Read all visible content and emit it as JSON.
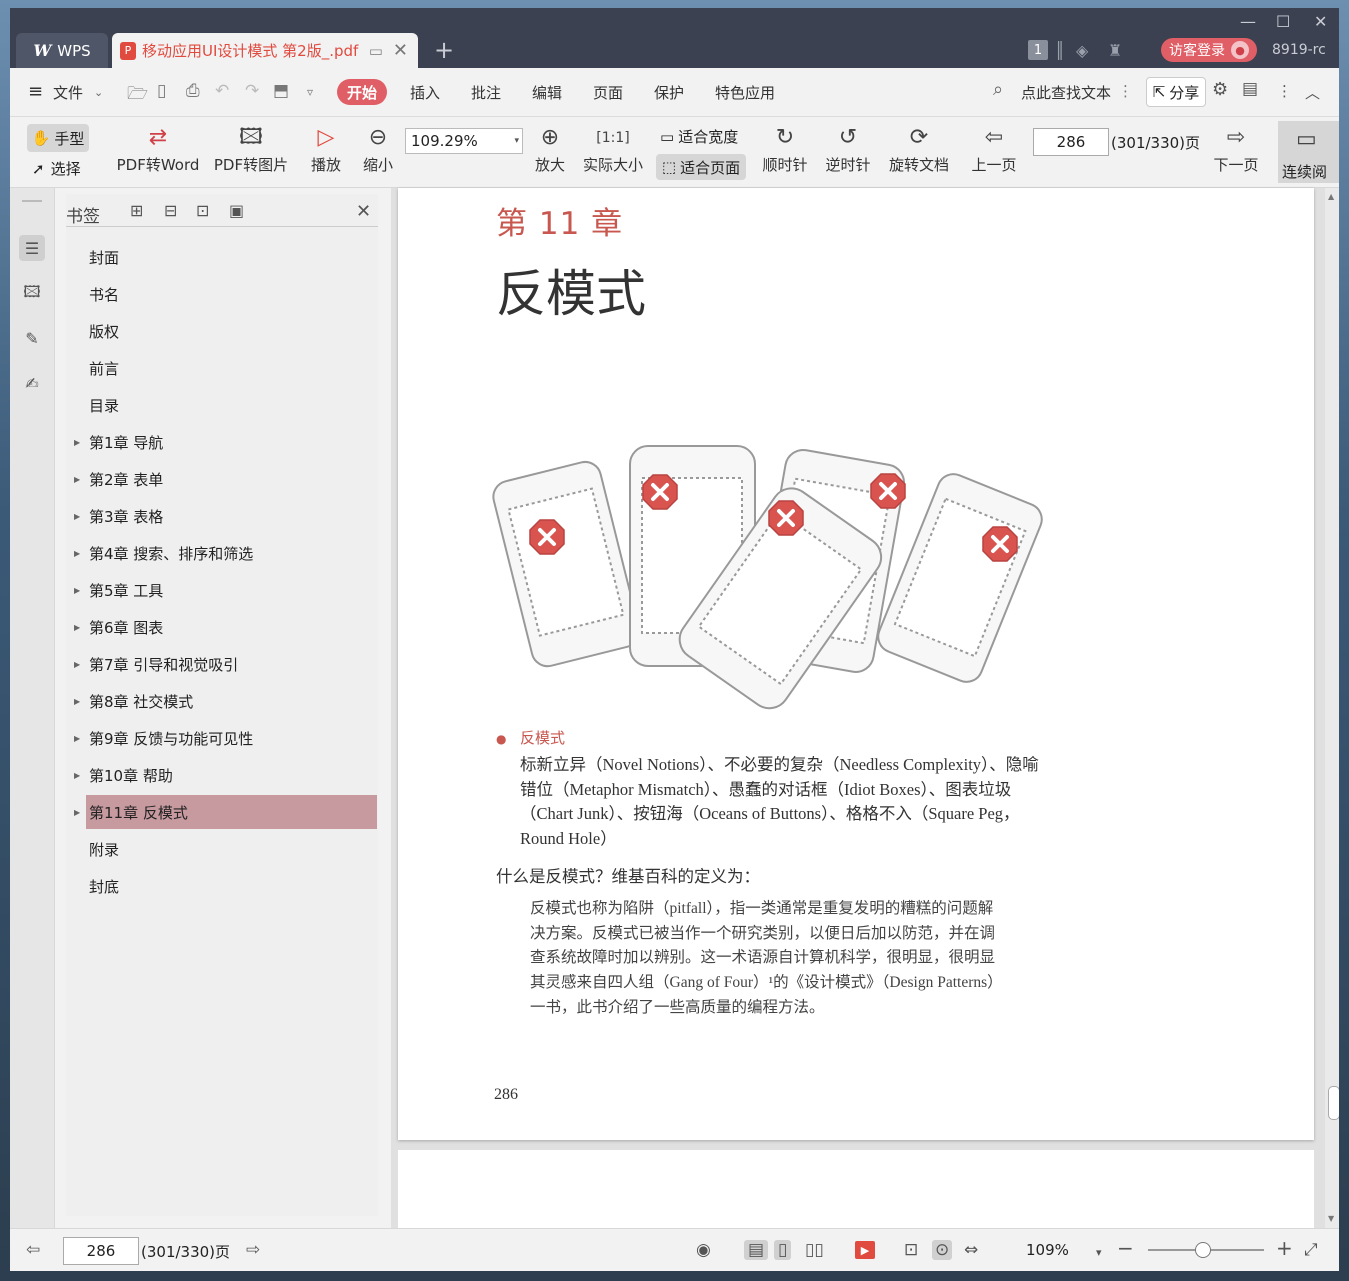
{
  "titlebar": {
    "app_tab": "WPS",
    "doc_tab": "移动应用UI设计模式 第2版_.pdf",
    "badge": "1",
    "login": "访客登录",
    "user": "8919-rc"
  },
  "menu": {
    "file": "文件",
    "tabs": [
      "开始",
      "插入",
      "批注",
      "编辑",
      "页面",
      "保护",
      "特色应用"
    ],
    "search_text": "点此查找文本",
    "share": "分享"
  },
  "toolbar": {
    "hand": "手型",
    "select": "选择",
    "pdf_to_word": "PDF转Word",
    "pdf_to_image": "PDF转图片",
    "play": "播放",
    "zoom_out": "缩小",
    "zoom_value": "109.29%",
    "zoom_in": "放大",
    "actual_size": "实际大小",
    "fit_width": "适合宽度",
    "fit_page": "适合页面",
    "clockwise": "顺时针",
    "counter_clockwise": "逆时针",
    "rotate_doc": "旋转文档",
    "prev_page": "上一页",
    "page_current": "286",
    "page_total": "(301/330)页",
    "next_page": "下一页",
    "continuous": "连续阅"
  },
  "bookmarks": {
    "title": "书签",
    "items": [
      {
        "label": "封面",
        "expandable": false,
        "selected": false
      },
      {
        "label": "书名",
        "expandable": false,
        "selected": false
      },
      {
        "label": "版权",
        "expandable": false,
        "selected": false
      },
      {
        "label": "前言",
        "expandable": false,
        "selected": false
      },
      {
        "label": "目录",
        "expandable": false,
        "selected": false
      },
      {
        "label": "第1章  导航",
        "expandable": true,
        "selected": false
      },
      {
        "label": "第2章  表单",
        "expandable": true,
        "selected": false
      },
      {
        "label": "第3章  表格",
        "expandable": true,
        "selected": false
      },
      {
        "label": "第4章  搜索、排序和筛选",
        "expandable": true,
        "selected": false
      },
      {
        "label": "第5章  工具",
        "expandable": true,
        "selected": false
      },
      {
        "label": "第6章  图表",
        "expandable": true,
        "selected": false
      },
      {
        "label": "第7章  引导和视觉吸引",
        "expandable": true,
        "selected": false
      },
      {
        "label": "第8章  社交模式",
        "expandable": true,
        "selected": false
      },
      {
        "label": "第9章  反馈与功能可见性",
        "expandable": true,
        "selected": false
      },
      {
        "label": "第10章  帮助",
        "expandable": true,
        "selected": false
      },
      {
        "label": "第11章  反模式",
        "expandable": true,
        "selected": true
      },
      {
        "label": "附录",
        "expandable": false,
        "selected": false
      },
      {
        "label": "封底",
        "expandable": false,
        "selected": false
      }
    ]
  },
  "page": {
    "chapter_no": "第 11 章",
    "chapter_title": "反模式",
    "bullet_label": "反模式",
    "bullet_body": "标新立异（Novel Notions）、不必要的复杂（Needless Complexity）、隐喻错位（Metaphor Mismatch）、愚蠢的对话框（Idiot Boxes）、图表垃圾（Chart Junk）、按钮海（Oceans of Buttons）、格格不入（Square Peg，Round Hole）",
    "question": "什么是反模式？维基百科的定义为：",
    "quote": "反模式也称为陷阱（pitfall），指一类通常是重复发明的糟糕的问题解决方案。反模式已被当作一个研究类别，以便日后加以防范，并在调查系统故障时加以辨别。这一术语源自计算机科学，很明显，很明显其灵感来自四人组（Gang of Four）¹的《设计模式》（Design Patterns）一书，此书介绍了一些高质量的编程方法。",
    "page_number": "286"
  },
  "statusbar": {
    "page_current": "286",
    "page_total": "(301/330)页",
    "zoom": "109%"
  },
  "colors": {
    "accent": "#e05e66",
    "chapter_red": "#c8584f",
    "titlebar": "#3b4150",
    "bookmark_selected": "#c79aa0"
  }
}
